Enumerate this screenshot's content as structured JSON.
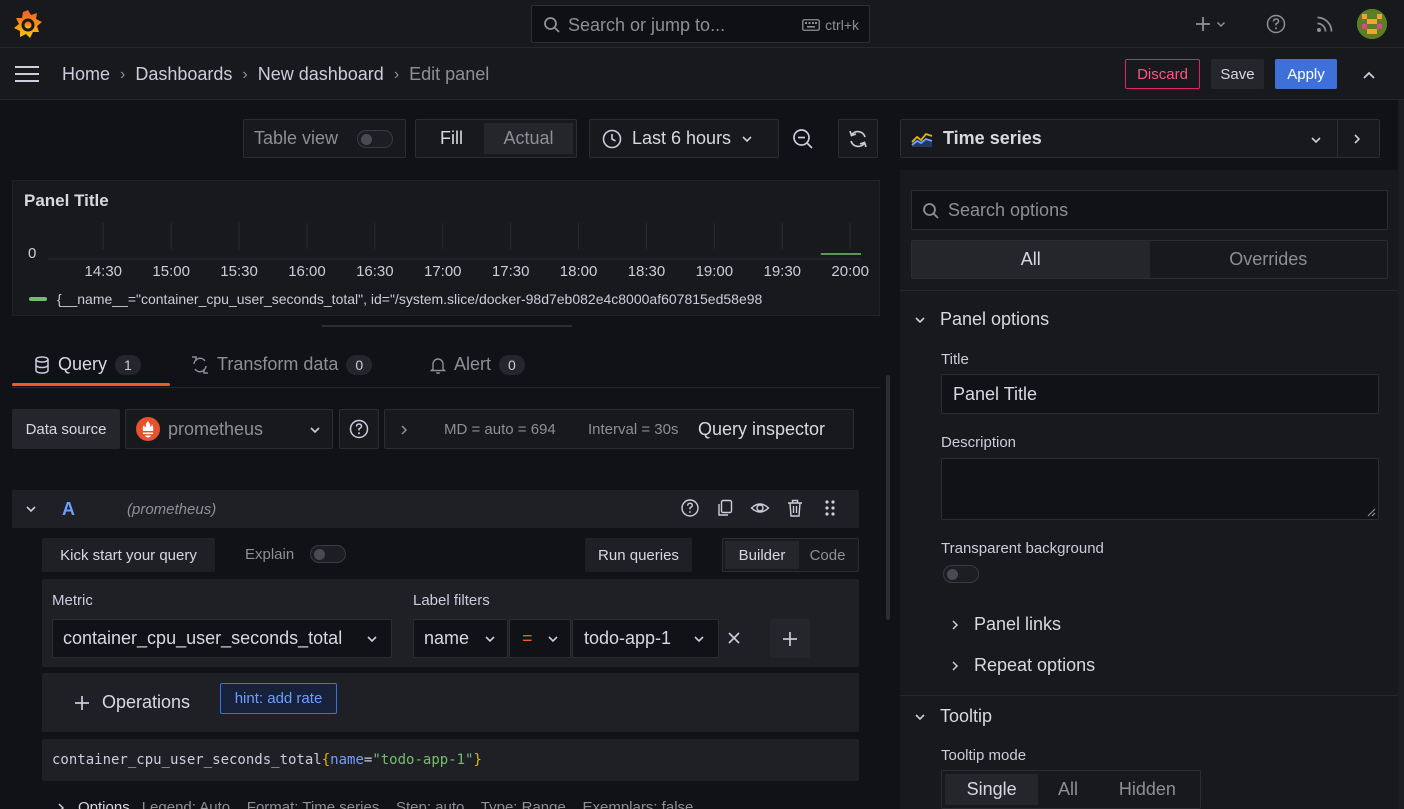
{
  "topbar": {
    "search_placeholder": "Search or jump to...",
    "search_shortcut": "ctrl+k"
  },
  "breadcrumb": {
    "items": [
      "Home",
      "Dashboards",
      "New dashboard",
      "Edit panel"
    ]
  },
  "actions": {
    "discard": "Discard",
    "save": "Save",
    "apply": "Apply"
  },
  "toolbar": {
    "table_view": "Table view",
    "fill": "Fill",
    "actual": "Actual",
    "time_range": "Last 6 hours",
    "visualization": "Time series"
  },
  "panel": {
    "title": "Panel Title",
    "y_tick": "0",
    "legend": "{__name__=\"container_cpu_user_seconds_total\", id=\"/system.slice/docker-98d7eb082e4c8000af607815ed58e98"
  },
  "chart_data": {
    "type": "line",
    "x_ticks": [
      "14:30",
      "15:00",
      "15:30",
      "16:00",
      "16:30",
      "17:00",
      "17:30",
      "18:00",
      "18:30",
      "19:00",
      "19:30",
      "20:00"
    ],
    "y_ticks": [
      "0"
    ],
    "series": [
      {
        "name": "{__name__=\"container_cpu_user_seconds_total\", id=\"/system.slice/docker-98d7eb082e4c8000af607815ed58e98",
        "color": "#73bf69",
        "x": [
          "19:47",
          "20:30"
        ],
        "y": [
          0,
          0
        ]
      }
    ],
    "grid": true
  },
  "tabs": [
    {
      "label": "Query",
      "count": "1"
    },
    {
      "label": "Transform data",
      "count": "0"
    },
    {
      "label": "Alert",
      "count": "0"
    }
  ],
  "datasource": {
    "label": "Data source",
    "value": "prometheus",
    "md": "MD = auto = 694",
    "interval": "Interval = 30s",
    "inspector": "Query inspector"
  },
  "query": {
    "ref": "A",
    "source": "(prometheus)",
    "kickstart": "Kick start your query",
    "explain": "Explain",
    "run": "Run queries",
    "builder": "Builder",
    "code": "Code",
    "metric_label": "Metric",
    "metric_value": "container_cpu_user_seconds_total",
    "label_filters": "Label filters",
    "filter_label": "name",
    "filter_op": "=",
    "filter_value": "todo-app-1",
    "operations": "Operations",
    "hint": "hint: add rate",
    "expr_metric": "container_cpu_user_seconds_total",
    "expr_brace_open": "{",
    "expr_label": "name",
    "expr_eq": "=",
    "expr_value": "\"todo-app-1\"",
    "expr_brace_close": "}",
    "options_title": "Options",
    "options_summary": "Legend: Auto    Format: Time series    Step: auto    Type: Range    Exemplars: false"
  },
  "options": {
    "search_placeholder": "Search options",
    "tab_all": "All",
    "tab_overrides": "Overrides",
    "panel_options": "Panel options",
    "title_label": "Title",
    "title_value": "Panel Title",
    "description_label": "Description",
    "transparent_label": "Transparent background",
    "panel_links": "Panel links",
    "repeat_options": "Repeat options",
    "tooltip": "Tooltip",
    "tooltip_mode": "Tooltip mode",
    "modes": [
      "Single",
      "All",
      "Hidden"
    ]
  },
  "colors": {
    "accent": "#3d71d9",
    "discard": "#e0226e",
    "query_underline": "#f05a28",
    "series": "#73bf69"
  }
}
